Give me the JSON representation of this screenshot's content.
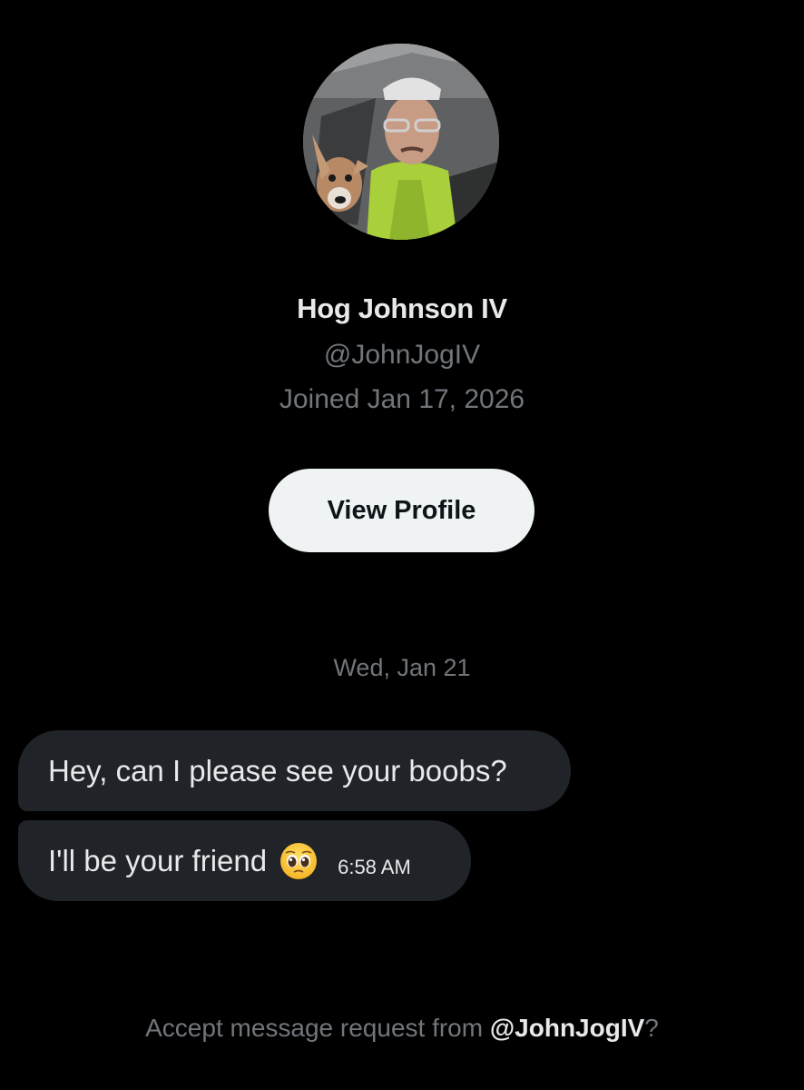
{
  "profile": {
    "display_name": "Hog Johnson IV",
    "handle": "@JohnJogIV",
    "joined": "Joined Jan 17, 2026",
    "avatar_icon": "profile-photo"
  },
  "actions": {
    "view_profile_label": "View Profile"
  },
  "conversation": {
    "date_separator": "Wed, Jan 21",
    "messages": [
      {
        "text": "Hey, can I please see your boobs?"
      },
      {
        "text": "I'll be your friend",
        "emoji": "pleading-face",
        "time": "6:58 AM"
      }
    ]
  },
  "request": {
    "prefix": "Accept message request from ",
    "handle": "@JohnJogIV",
    "suffix": "?"
  },
  "colors": {
    "background": "#000000",
    "primary_text": "#e7e9ea",
    "secondary_text": "#71767b",
    "bubble": "#202327",
    "button_bg": "#eff3f4"
  }
}
